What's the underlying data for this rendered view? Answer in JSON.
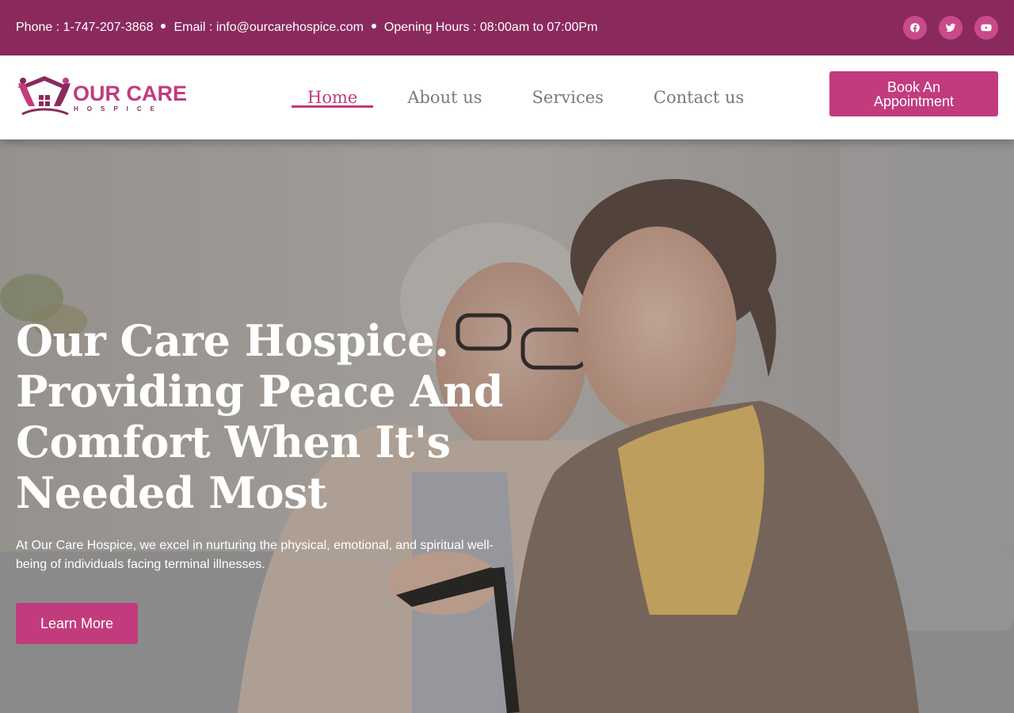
{
  "topbar": {
    "phone": "Phone : 1-747-207-3868",
    "email": "Email : info@ourcarehospice.com",
    "hours": "Opening Hours : 08:00am to 07:00Pm",
    "socials": [
      "facebook-icon",
      "twitter-icon",
      "youtube-icon"
    ]
  },
  "logo": {
    "main": "OUR CARE",
    "sub": "HOSPICE"
  },
  "nav": {
    "items": [
      {
        "label": "Home",
        "active": true
      },
      {
        "label": "About us",
        "active": false
      },
      {
        "label": "Services",
        "active": false
      },
      {
        "label": "Contact us",
        "active": false
      }
    ],
    "cta": "Book An Appointment"
  },
  "hero": {
    "title": "Our Care Hospice. Providing Peace And Comfort When It's Needed Most",
    "description": "At Our Care Hospice, we excel in nurturing the physical, emotional, and spiritual well-being of individuals facing terminal illnesses.",
    "button": "Learn More",
    "image": "hero-photo-elderly-woman-and-caregiver"
  },
  "colors": {
    "topbar": "#8a2a5c",
    "accent": "#c23b7d",
    "social_bg": "#c84a8a",
    "nav_text": "#7a7a7a"
  }
}
